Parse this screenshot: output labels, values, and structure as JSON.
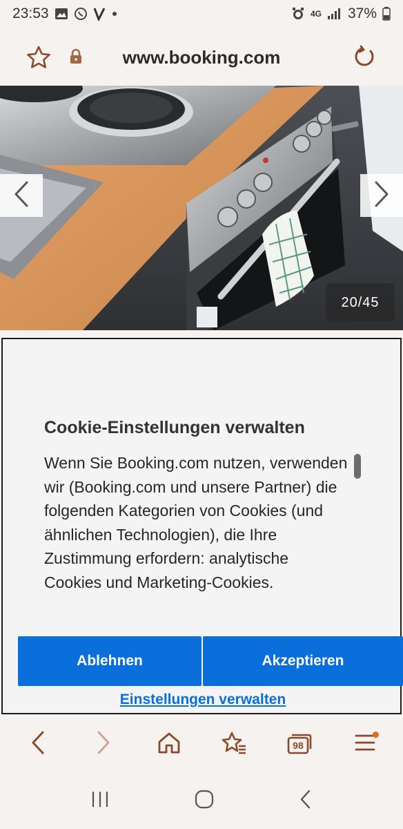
{
  "status_bar": {
    "time": "23:53",
    "network": "4G",
    "battery": "37%"
  },
  "url_bar": {
    "url": "www.booking.com"
  },
  "gallery": {
    "counter": "20/45"
  },
  "cookie_dialog": {
    "title": "Cookie-Einstellungen verwalten",
    "body": "Wenn Sie Booking.com nutzen, verwenden wir (Booking.com und unsere Partner) die folgenden Kategorien von Cookies (und ähnlichen Technologien), die Ihre Zustimmung erfordern: analytische Cookies und Marketing-Cookies.",
    "reject_label": "Ablehnen",
    "accept_label": "Akzeptieren",
    "manage_label": "Einstellungen verwalten"
  },
  "toolbar": {
    "tabs_count": "98"
  },
  "colors": {
    "accent_brown": "#8a4a2a",
    "button_blue": "#0a6edb",
    "notification_orange": "#e36a1c"
  },
  "icons": [
    "star-icon",
    "lock-icon",
    "reload-icon",
    "chevron-left-icon",
    "chevron-right-icon",
    "back-icon",
    "forward-icon",
    "home-icon",
    "bookmarks-icon",
    "tabs-icon",
    "menu-icon"
  ]
}
